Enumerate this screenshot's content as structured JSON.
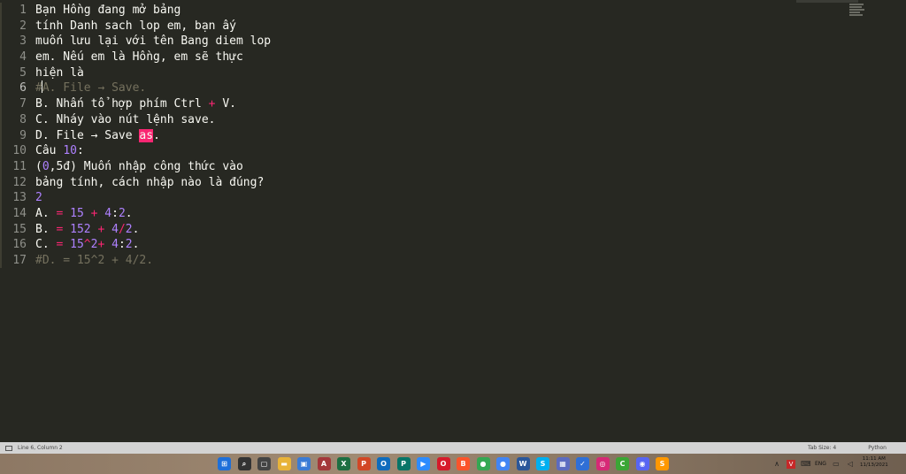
{
  "lines": [
    {
      "num": "1",
      "segments": [
        {
          "t": "Bạn Hồng đang mở bảng",
          "c": ""
        }
      ]
    },
    {
      "num": "2",
      "segments": [
        {
          "t": "tính Danh sach lop em, bạn ấy",
          "c": ""
        }
      ]
    },
    {
      "num": "3",
      "segments": [
        {
          "t": "muốn lưu lại với tên Bang diem lop",
          "c": ""
        }
      ]
    },
    {
      "num": "4",
      "segments": [
        {
          "t": "em. Nếu em là Hồng, em sẽ thực",
          "c": ""
        }
      ]
    },
    {
      "num": "5",
      "segments": [
        {
          "t": "hiện là",
          "c": ""
        }
      ]
    },
    {
      "num": "6",
      "dim": true,
      "current": true,
      "segments": [
        {
          "t": "#",
          "c": ""
        },
        {
          "t": "",
          "c": "caret"
        },
        {
          "t": "A. File → Save.",
          "c": ""
        }
      ]
    },
    {
      "num": "7",
      "segments": [
        {
          "t": "B. Nhấn tổ hợp phím Ctrl ",
          "c": ""
        },
        {
          "t": "+",
          "c": "op"
        },
        {
          "t": " V.",
          "c": ""
        }
      ]
    },
    {
      "num": "8",
      "segments": [
        {
          "t": "C. Nháy vào nút lệnh save.",
          "c": ""
        }
      ]
    },
    {
      "num": "9",
      "segments": [
        {
          "t": "D. File → Save ",
          "c": ""
        },
        {
          "t": "as",
          "c": "hl"
        },
        {
          "t": ".",
          "c": ""
        }
      ]
    },
    {
      "num": "10",
      "segments": [
        {
          "t": "Câu ",
          "c": ""
        },
        {
          "t": "10",
          "c": "num"
        },
        {
          "t": ":",
          "c": ""
        }
      ]
    },
    {
      "num": "11",
      "segments": [
        {
          "t": "(",
          "c": ""
        },
        {
          "t": "0",
          "c": "num"
        },
        {
          "t": ",5đ) Muốn nhập công thức vào",
          "c": ""
        }
      ]
    },
    {
      "num": "12",
      "segments": [
        {
          "t": "bảng tính, cách nhập nào là đúng?",
          "c": ""
        }
      ]
    },
    {
      "num": "13",
      "segments": [
        {
          "t": "2",
          "c": "num"
        }
      ]
    },
    {
      "num": "14",
      "segments": [
        {
          "t": "A. ",
          "c": ""
        },
        {
          "t": "=",
          "c": "op"
        },
        {
          "t": " ",
          "c": ""
        },
        {
          "t": "15",
          "c": "num"
        },
        {
          "t": " ",
          "c": ""
        },
        {
          "t": "+",
          "c": "op"
        },
        {
          "t": " ",
          "c": ""
        },
        {
          "t": "4",
          "c": "num"
        },
        {
          "t": ":",
          "c": ""
        },
        {
          "t": "2",
          "c": "num"
        },
        {
          "t": ".",
          "c": ""
        }
      ]
    },
    {
      "num": "15",
      "segments": [
        {
          "t": "B. ",
          "c": ""
        },
        {
          "t": "=",
          "c": "op"
        },
        {
          "t": " ",
          "c": ""
        },
        {
          "t": "152",
          "c": "num"
        },
        {
          "t": " ",
          "c": ""
        },
        {
          "t": "+",
          "c": "op"
        },
        {
          "t": " ",
          "c": ""
        },
        {
          "t": "4",
          "c": "num"
        },
        {
          "t": "/",
          "c": "op"
        },
        {
          "t": "2",
          "c": "num"
        },
        {
          "t": ".",
          "c": ""
        }
      ]
    },
    {
      "num": "16",
      "segments": [
        {
          "t": "C. ",
          "c": ""
        },
        {
          "t": "=",
          "c": "op"
        },
        {
          "t": " ",
          "c": ""
        },
        {
          "t": "15",
          "c": "num"
        },
        {
          "t": "^",
          "c": "op"
        },
        {
          "t": "2",
          "c": "num"
        },
        {
          "t": "+",
          "c": "op"
        },
        {
          "t": " ",
          "c": ""
        },
        {
          "t": "4",
          "c": "num"
        },
        {
          "t": ":",
          "c": ""
        },
        {
          "t": "2",
          "c": "num"
        },
        {
          "t": ".",
          "c": ""
        }
      ]
    },
    {
      "num": "17",
      "dim": true,
      "segments": [
        {
          "t": "#D. = 15^2 + 4/2.",
          "c": ""
        }
      ]
    }
  ],
  "status": {
    "position": "Line 6, Column 2",
    "tab_size": "Tab Size: 4",
    "syntax": "Python"
  },
  "taskbar": {
    "apps": [
      {
        "icon": "windows-start-icon",
        "glyph": "⊞",
        "color": "#1e6fd9"
      },
      {
        "icon": "search-icon",
        "glyph": "⌕",
        "color": "#333333"
      },
      {
        "icon": "task-view-icon",
        "glyph": "▢",
        "color": "#444444"
      },
      {
        "icon": "file-explorer-icon",
        "glyph": "▬",
        "color": "#e8b339"
      },
      {
        "icon": "store-icon",
        "glyph": "▣",
        "color": "#3a7bd5"
      },
      {
        "icon": "access-icon",
        "glyph": "A",
        "color": "#a4373a"
      },
      {
        "icon": "excel-icon",
        "glyph": "X",
        "color": "#1d6f42"
      },
      {
        "icon": "powerpoint-icon",
        "glyph": "P",
        "color": "#d24726"
      },
      {
        "icon": "outlook-icon",
        "glyph": "O",
        "color": "#0f6cbd"
      },
      {
        "icon": "publisher-icon",
        "glyph": "P",
        "color": "#077568"
      },
      {
        "icon": "zoom-icon",
        "glyph": "▶",
        "color": "#2d8cff"
      },
      {
        "icon": "opera-icon",
        "glyph": "O",
        "color": "#d61b2b"
      },
      {
        "icon": "brave-icon",
        "glyph": "B",
        "color": "#fb542b"
      },
      {
        "icon": "chrome-icon",
        "glyph": "●",
        "color": "#34a853"
      },
      {
        "icon": "chrome-alt-icon",
        "glyph": "●",
        "color": "#4285f4"
      },
      {
        "icon": "word-icon",
        "glyph": "W",
        "color": "#2b579a"
      },
      {
        "icon": "skype-icon",
        "glyph": "S",
        "color": "#00aff0"
      },
      {
        "icon": "photos-icon",
        "glyph": "▦",
        "color": "#5c6bc0"
      },
      {
        "icon": "security-icon",
        "glyph": "✓",
        "color": "#2f6fd6"
      },
      {
        "icon": "instagram-icon",
        "glyph": "◎",
        "color": "#d62976"
      },
      {
        "icon": "camtasia-icon",
        "glyph": "C",
        "color": "#3ba635"
      },
      {
        "icon": "discord-icon",
        "glyph": "◉",
        "color": "#5865f2"
      },
      {
        "icon": "sublime-text-icon",
        "glyph": "S",
        "color": "#ff9800"
      }
    ],
    "tray": {
      "chevron": "∧",
      "lang": "ENG",
      "time": "11:11 AM",
      "date": "11/13/2021"
    }
  }
}
